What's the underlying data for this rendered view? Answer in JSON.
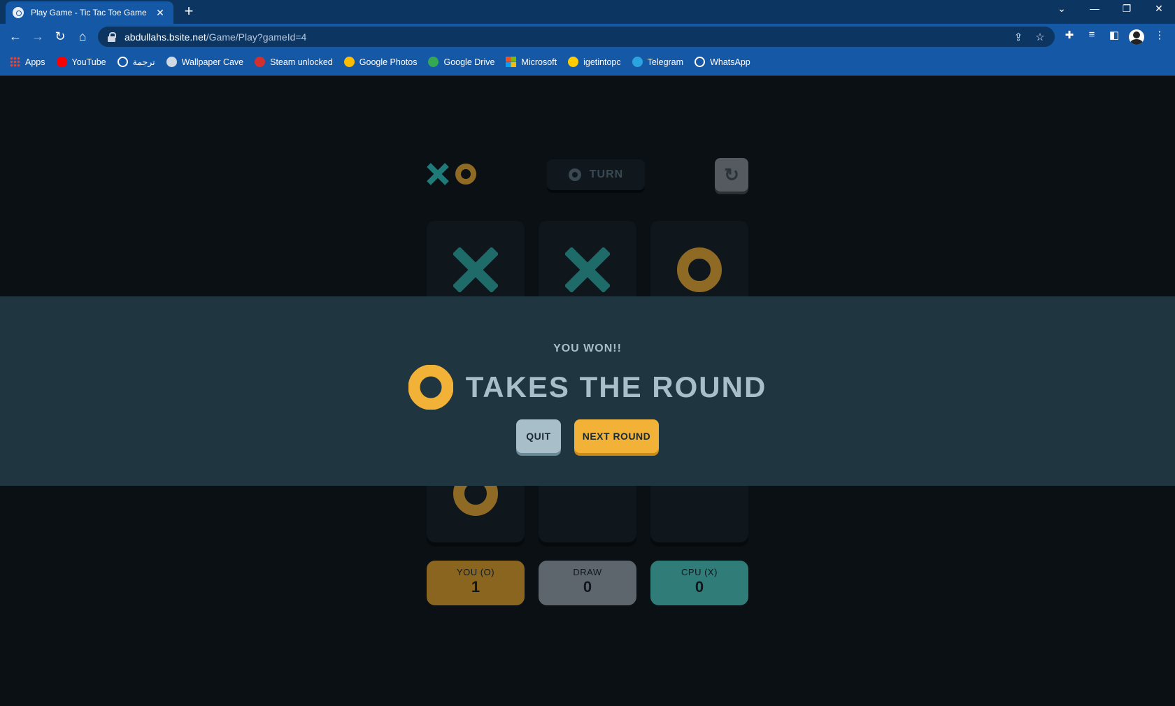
{
  "browser": {
    "tab_title": "Play Game - Tic Tac Toe Game",
    "url_host": "abdullahs.bsite.net",
    "url_path": "/Game/Play?gameId=4",
    "bookmarks": [
      {
        "label": "Apps",
        "icon": "apps-grid-icon",
        "color": "#ea4335"
      },
      {
        "label": "YouTube",
        "icon": "youtube-icon",
        "color": "#ff0000"
      },
      {
        "label": "ترجمة",
        "icon": "globe-icon",
        "color": "#ffffff"
      },
      {
        "label": "Wallpaper Cave",
        "icon": "wallpaper-cave-icon",
        "color": "#cfd8e3"
      },
      {
        "label": "Steam unlocked",
        "icon": "steam-unlocked-icon",
        "color": "#d32f2f"
      },
      {
        "label": "Google Photos",
        "icon": "google-photos-icon",
        "color": "#fbbc04"
      },
      {
        "label": "Google Drive",
        "icon": "google-drive-icon",
        "color": "#34a853"
      },
      {
        "label": "Microsoft",
        "icon": "microsoft-icon",
        "color": "#f25022"
      },
      {
        "label": "igetintopc",
        "icon": "igetintopc-icon",
        "color": "#ffcc00"
      },
      {
        "label": "Telegram",
        "icon": "telegram-icon",
        "color": "#2aa3e0"
      },
      {
        "label": "WhatsApp",
        "icon": "whatsapp-icon",
        "color": "#ffffff"
      }
    ]
  },
  "game": {
    "turn_label": "TURN",
    "board": [
      "X",
      "X",
      "O",
      "",
      "",
      "",
      "O",
      "",
      ""
    ],
    "scores": [
      {
        "label": "YOU (O)",
        "value": "1",
        "color": "#f2b137"
      },
      {
        "label": "DRAW",
        "value": "0",
        "color": "#a8bfc9"
      },
      {
        "label": "CPU (X)",
        "value": "0",
        "color": "#31c3bd"
      }
    ],
    "colors": {
      "x": "#31c3bd",
      "o": "#f2b137",
      "silver": "#a8bfc9"
    }
  },
  "result": {
    "subtitle": "YOU WON!!",
    "headline": "TAKES THE ROUND",
    "winner_mark": "O",
    "quit_label": "QUIT",
    "next_label": "NEXT ROUND"
  }
}
